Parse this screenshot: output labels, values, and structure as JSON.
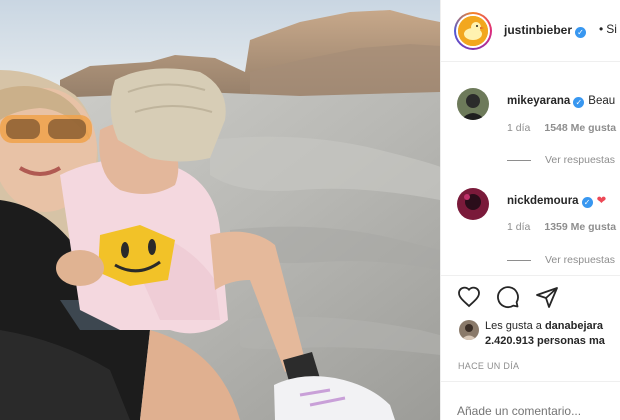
{
  "post": {
    "username": "justinbieber",
    "follow_label": "Si",
    "follow_separator": "•"
  },
  "comments": [
    {
      "username": "mikeyarana",
      "text": "Beau",
      "time": "1 día",
      "likes": "1548 Me gusta",
      "view_replies": "Ver respuestas"
    },
    {
      "username": "nickdemoura",
      "text": "",
      "time": "1 día",
      "likes": "1359 Me gusta",
      "view_replies": "Ver respuestas"
    }
  ],
  "likes_summary": {
    "prefix": "Les gusta a",
    "first_user": "danabejara",
    "total": "2.420.913 personas ma"
  },
  "timestamp": "HACE UN DÍA",
  "add_comment": {
    "placeholder": "Añade un comentario..."
  },
  "colors": {
    "verified": "#3897f0",
    "heart": "#ed4956",
    "muted": "#8e8e8e",
    "text": "#262626"
  },
  "icons": [
    "heart-icon",
    "comment-icon",
    "share-icon",
    "verified-icon"
  ]
}
